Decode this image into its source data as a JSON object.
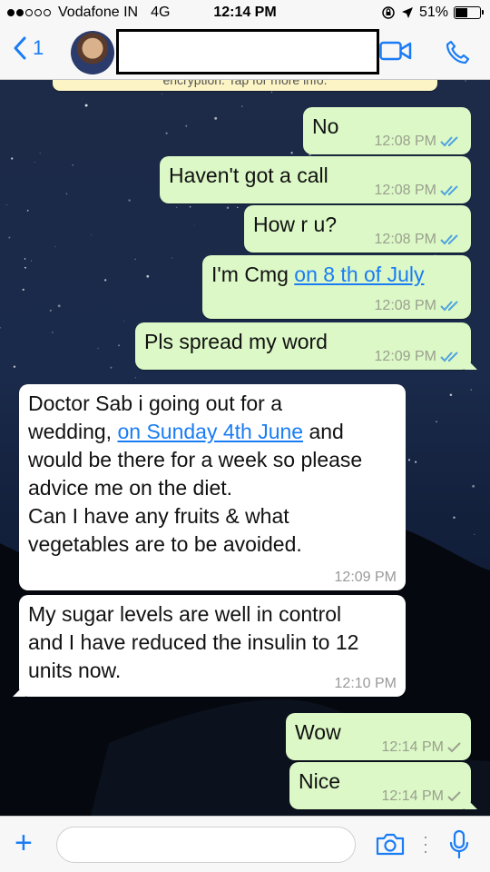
{
  "status_bar": {
    "carrier": "Vodafone IN",
    "network": "4G",
    "time": "12:14 PM",
    "battery": "51%",
    "battery_level": 0.51
  },
  "nav": {
    "back_count": "1"
  },
  "chat": {
    "encryption_text": "encryption. Tap for more info.",
    "messages": [
      {
        "text": "No",
        "time": "12:08 PM"
      },
      {
        "text": "Haven't got a call",
        "time": "12:08 PM"
      },
      {
        "text": "How r u?",
        "time": "12:08 PM"
      },
      {
        "text_before": "I'm Cmg ",
        "link": "on 8 th of July",
        "time": "12:08 PM"
      },
      {
        "text": "Pls spread my word",
        "time": "12:09 PM"
      },
      {
        "line1": "Doctor Sab i going out for a",
        "line2_before": "wedding, ",
        "link": "on Sunday 4th June",
        "line2_after": " and",
        "line3": "would be there for a week so please",
        "line4": "advice me on the diet.",
        "line5": "Can I have any fruits & what",
        "line6": "vegetables are to be avoided.",
        "time": "12:09 PM"
      },
      {
        "line1": "My sugar levels are well in control",
        "line2": "and I have reduced the insulin to 12",
        "line3": "units now.",
        "time": "12:10 PM"
      },
      {
        "text": "Wow",
        "time": "12:14 PM"
      },
      {
        "text": "Nice",
        "time": "12:14 PM"
      }
    ]
  },
  "input": {
    "placeholder": ""
  },
  "colors": {
    "accent": "#1a7cf5",
    "outgoing": "#dcf8c6",
    "incoming": "#ffffff",
    "read_ticks": "#4fa3e0",
    "delivered_ticks": "#9aa08f"
  }
}
